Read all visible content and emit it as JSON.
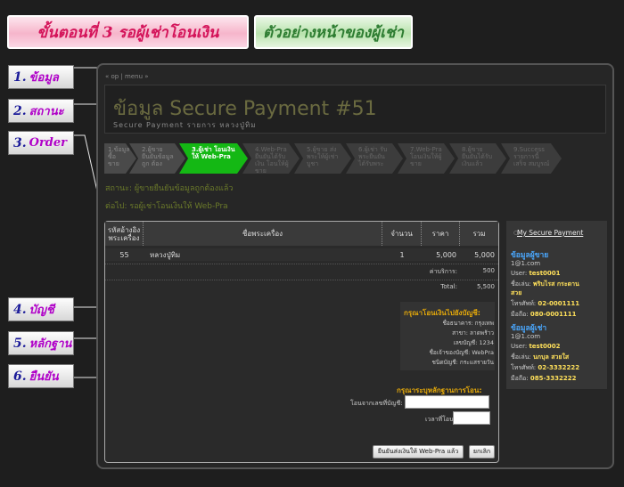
{
  "banners": {
    "step": "ขั้นตอนที่ 3 รอผู้เช่าโอนเงิน",
    "preview": "ตัวอย่างหน้าของผู้เช่า"
  },
  "callouts": [
    {
      "num": "1.",
      "text": "ข้อมูล"
    },
    {
      "num": "2.",
      "text": "สถานะ"
    },
    {
      "num": "3.",
      "text": "Order"
    },
    {
      "num": "4.",
      "text": "บัญชี"
    },
    {
      "num": "5.",
      "text": "หลักฐาน"
    },
    {
      "num": "6.",
      "text": "ยืนยัน"
    }
  ],
  "breadcrumb": "« op | menu »",
  "header": {
    "title": "ข้อมูล Secure Payment #51",
    "subtitle": "Secure Payment รายการ หลวงปู่ทิม"
  },
  "steps": [
    {
      "label": "1.ข้อมูล ซื้อขาย",
      "state": "done"
    },
    {
      "label": "2.ผู้ขาย ยืนยันข้อมูลถูก ต้อง",
      "state": "done"
    },
    {
      "label": "3.ผู้เช่า โอนเงินให้ Web-Pra",
      "state": "active"
    },
    {
      "label": "4.Web-Pra ยืนยันได้รับเงิน โอนให้ผู้ขาย",
      "state": "pending"
    },
    {
      "label": "5.ผู้ขาย ส่งพระให้ผู้เช่า บูชา",
      "state": "pending"
    },
    {
      "label": "6.ผู้เช่า รับพระยืนยัน ได้รับพระ",
      "state": "pending"
    },
    {
      "label": "7.Web-Pra โอนเงินให้ผู้ขาย",
      "state": "pending"
    },
    {
      "label": "8.ผู้ขาย ยืนยันได้รับ เงินแล้ว",
      "state": "pending"
    },
    {
      "label": "9.Success รายการนี้เสร็จ สมบูรณ์",
      "state": "pending"
    }
  ],
  "status": "สถานะ: ผู้ขายยืนยันข้อมูลถูกต้องแล้ว",
  "next": "ต่อไป: รอผู้เช่าโอนเงินให้ Web-Pra",
  "table": {
    "headers": [
      "รหัสอ้างอิง พระเครื่อง",
      "ชื่อพระเครื่อง",
      "จำนวน",
      "ราคา",
      "รวม"
    ],
    "rows": [
      {
        "id": "55",
        "name": "หลวงปู่ทิม",
        "qty": "1",
        "price": "5,000",
        "total": "5,000"
      }
    ],
    "service_label": "ค่าบริการ:",
    "service_value": "500",
    "total_label": "Total:",
    "total_value": "5,500"
  },
  "bank": {
    "title": "กรุณาโอนเงินไปยังบัญชี:",
    "lines": [
      "ชื่อธนาคาร: กรุงเทพ",
      "สาขา: ลาดพร้าว",
      "เลขบัญชี: 1234",
      "ชื่อเจ้าของบัญชี: WebPra",
      "ชนิดบัญชี: กระแสรายวัน"
    ]
  },
  "confirm": {
    "title": "กรุณาระบุหลักฐานการโอน:",
    "from_account_label": "โอนจากเลขที่บัญชี:",
    "from_account_value": "",
    "time_label": "เวลาที่โอน:",
    "time_value": "",
    "submit_label": "ยืนยันส่งเงินให้ Web-Pra แล้ว",
    "cancel_label": "ยกเลิก"
  },
  "sidebar": {
    "link": "My Secure Payment",
    "seller_title": "ข้อมูลผู้ขาย",
    "seller_email": "1@1.com",
    "seller_user_label": "User:",
    "seller_user": "test0001",
    "seller_name_label": "ชื่อเล่น:",
    "seller_name": "พริบไรส กระดาน",
    "seller_name2": "สวย",
    "seller_phone_label": "โทรศัพท์:",
    "seller_phone": "02-0001111",
    "seller_mobile_label": "มือถือ:",
    "seller_mobile": "080-0001111",
    "buyer_title": "ข้อมูลผู้เช่า",
    "buyer_email": "1@1.com",
    "buyer_user_label": "User:",
    "buyer_user": "test0002",
    "buyer_name_label": "ชื่อเล่น:",
    "buyer_name": "นกบุล สวยใส",
    "buyer_phone_label": "โทรศัพท์:",
    "buyer_phone": "02-3332222",
    "buyer_mobile_label": "มือถือ:",
    "buyer_mobile": "085-3332222"
  },
  "colors": {
    "accent_green": "#14b814",
    "heading_orange": "#e5a90a",
    "sidebar_blue": "#4aa8ff"
  }
}
